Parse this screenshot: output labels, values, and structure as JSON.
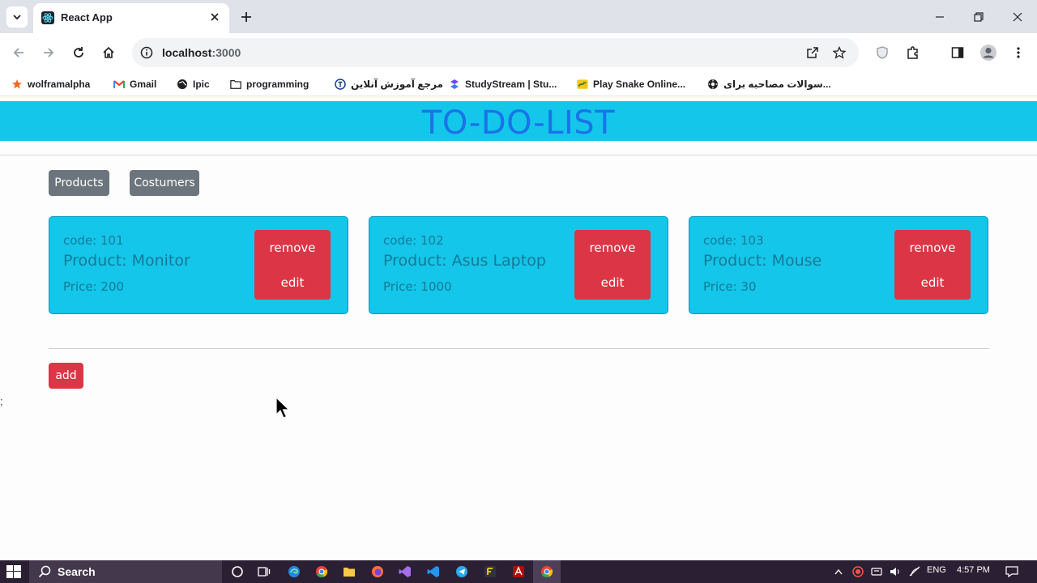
{
  "browser": {
    "tab_title": "React App",
    "url_host": "localhost",
    "url_port": ":3000",
    "bookmarks": [
      {
        "label": "wolframalpha",
        "icon": "wolfram-icon"
      },
      {
        "label": "Gmail",
        "icon": "gmail-icon"
      },
      {
        "label": "Ipic",
        "icon": "globe-icon"
      },
      {
        "label": "programming",
        "icon": "folder-icon"
      },
      {
        "label": "مرجع آموزش آنلاین",
        "icon": "site-icon"
      },
      {
        "label": "StudyStream | Stu...",
        "icon": "studystream-icon"
      },
      {
        "label": "Play Snake Online...",
        "icon": "snake-icon"
      },
      {
        "label": "سوالات مصاحبه برای...",
        "icon": "gear-site-icon"
      }
    ]
  },
  "app": {
    "title": "TO-DO-LIST",
    "nav": {
      "products": "Products",
      "customers": "Costumers"
    },
    "products": [
      {
        "code": "code: 101",
        "name": "Product: Monitor",
        "price": "Price: 200"
      },
      {
        "code": "code: 102",
        "name": "Product: Asus Laptop",
        "price": "Price: 1000"
      },
      {
        "code": "code: 103",
        "name": "Product: Mouse",
        "price": "Price: 30"
      }
    ],
    "card_actions": {
      "remove": "remove",
      "edit": "edit"
    },
    "add_label": "add",
    "stray_text": ";"
  },
  "taskbar": {
    "search_label": "Search",
    "lang": "ENG",
    "time": "4:57 PM"
  },
  "colors": {
    "header": "#13c6ea",
    "title": "#1a73e8",
    "danger": "#dc3545",
    "secondary": "#6c757d"
  }
}
